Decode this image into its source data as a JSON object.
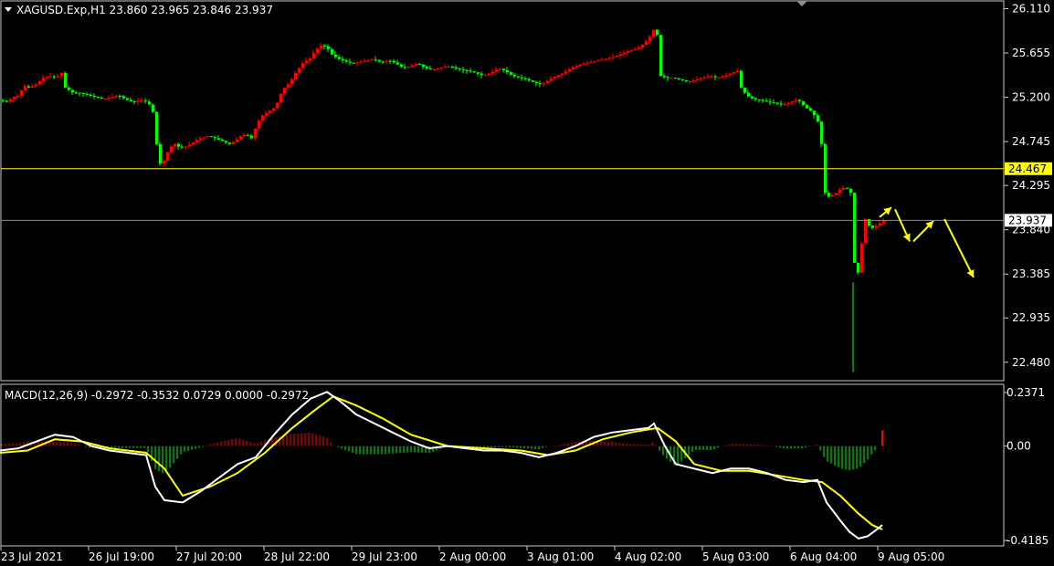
{
  "main_panel": {
    "title": "XAGUSD.Exp,H1  23.860 23.965 23.846 23.937",
    "y_range": [
      22.3,
      26.18
    ],
    "y_ticks": [
      "26.110",
      "25.655",
      "25.200",
      "24.745",
      "24.295",
      "23.840",
      "23.385",
      "22.935",
      "22.480"
    ],
    "hline_level": 24.467,
    "hline_label": "24.467",
    "current_price": 23.937,
    "current_price_label": "23.937",
    "colors": {
      "bull": "#ff0000",
      "bear": "#00ff00",
      "hline": "#ffff00",
      "current_line": "#8c8c9a",
      "arrow": "#ffff00"
    }
  },
  "macd_panel": {
    "title": "MACD(12,26,9) -0.2972 -0.3532 0.0729 0.0000 -0.2972",
    "y_range": [
      -0.4185,
      0.2371
    ],
    "y_ticks": [
      "0.2371",
      "0.00",
      "-0.4185"
    ],
    "colors": {
      "macd": "#ffffff",
      "signal": "#ffff00",
      "hist_pos": "#ff0000",
      "hist_neg": "#00ff00"
    }
  },
  "x_axis_labels": [
    "23 Jul 2021",
    "26 Jul 19:00",
    "27 Jul 20:00",
    "28 Jul 22:00",
    "29 Jul 23:00",
    "2 Aug 00:00",
    "3 Aug 01:00",
    "4 Aug 02:00",
    "5 Aug 03:00",
    "6 Aug 04:00",
    "9 Aug 05:00"
  ],
  "chart_data": [
    {
      "type": "candlestick",
      "symbol": "XAGUSD.Exp",
      "timeframe": "H1",
      "ohlc_last": {
        "open": 23.86,
        "high": 23.965,
        "low": 23.846,
        "close": 23.937
      },
      "horizontal_line": 24.467,
      "path": [
        [
          0,
          25.17
        ],
        [
          7,
          25.15
        ],
        [
          12,
          25.2
        ],
        [
          20,
          25.22
        ],
        [
          24,
          25.32
        ],
        [
          30,
          25.3
        ],
        [
          38,
          25.33
        ],
        [
          46,
          25.4
        ],
        [
          52,
          25.42
        ],
        [
          60,
          25.4
        ],
        [
          66,
          25.45
        ],
        [
          70,
          25.3
        ],
        [
          78,
          25.25
        ],
        [
          88,
          25.24
        ],
        [
          96,
          25.22
        ],
        [
          104,
          25.2
        ],
        [
          112,
          25.18
        ],
        [
          120,
          25.2
        ],
        [
          128,
          25.22
        ],
        [
          136,
          25.18
        ],
        [
          144,
          25.15
        ],
        [
          152,
          25.17
        ],
        [
          160,
          25.15
        ],
        [
          164,
          25.1
        ],
        [
          168,
          25.0
        ],
        [
          170,
          24.72
        ],
        [
          174,
          24.52
        ],
        [
          178,
          24.55
        ],
        [
          184,
          24.68
        ],
        [
          190,
          24.72
        ],
        [
          196,
          24.68
        ],
        [
          204,
          24.7
        ],
        [
          212,
          24.75
        ],
        [
          218,
          24.78
        ],
        [
          226,
          24.8
        ],
        [
          234,
          24.78
        ],
        [
          242,
          24.75
        ],
        [
          250,
          24.72
        ],
        [
          256,
          24.75
        ],
        [
          262,
          24.8
        ],
        [
          268,
          24.82
        ],
        [
          274,
          24.78
        ],
        [
          278,
          24.88
        ],
        [
          284,
          25.0
        ],
        [
          292,
          25.05
        ],
        [
          300,
          25.1
        ],
        [
          308,
          25.28
        ],
        [
          316,
          25.35
        ],
        [
          322,
          25.45
        ],
        [
          330,
          25.55
        ],
        [
          338,
          25.6
        ],
        [
          344,
          25.68
        ],
        [
          350,
          25.73
        ],
        [
          356,
          25.72
        ],
        [
          362,
          25.64
        ],
        [
          368,
          25.6
        ],
        [
          376,
          25.57
        ],
        [
          384,
          25.55
        ],
        [
          392,
          25.56
        ],
        [
          400,
          25.58
        ],
        [
          408,
          25.59
        ],
        [
          416,
          25.56
        ],
        [
          424,
          25.58
        ],
        [
          432,
          25.55
        ],
        [
          440,
          25.5
        ],
        [
          448,
          25.52
        ],
        [
          456,
          25.55
        ],
        [
          464,
          25.5
        ],
        [
          472,
          25.48
        ],
        [
          480,
          25.5
        ],
        [
          488,
          25.52
        ],
        [
          496,
          25.5
        ],
        [
          504,
          25.48
        ],
        [
          512,
          25.47
        ],
        [
          520,
          25.45
        ],
        [
          528,
          25.42
        ],
        [
          536,
          25.45
        ],
        [
          544,
          25.5
        ],
        [
          552,
          25.47
        ],
        [
          560,
          25.42
        ],
        [
          568,
          25.4
        ],
        [
          576,
          25.38
        ],
        [
          584,
          25.35
        ],
        [
          592,
          25.33
        ],
        [
          600,
          25.38
        ],
        [
          608,
          25.42
        ],
        [
          616,
          25.45
        ],
        [
          624,
          25.5
        ],
        [
          632,
          25.53
        ],
        [
          640,
          25.55
        ],
        [
          648,
          25.57
        ],
        [
          656,
          25.58
        ],
        [
          664,
          25.6
        ],
        [
          672,
          25.62
        ],
        [
          680,
          25.65
        ],
        [
          688,
          25.68
        ],
        [
          696,
          25.7
        ],
        [
          704,
          25.75
        ],
        [
          710,
          25.82
        ],
        [
          716,
          25.93
        ],
        [
          720,
          25.75
        ],
        [
          722,
          25.42
        ],
        [
          728,
          25.4
        ],
        [
          736,
          25.4
        ],
        [
          744,
          25.38
        ],
        [
          752,
          25.36
        ],
        [
          760,
          25.38
        ],
        [
          768,
          25.4
        ],
        [
          776,
          25.42
        ],
        [
          784,
          25.4
        ],
        [
          792,
          25.42
        ],
        [
          800,
          25.45
        ],
        [
          806,
          25.47
        ],
        [
          810,
          25.3
        ],
        [
          816,
          25.22
        ],
        [
          824,
          25.18
        ],
        [
          832,
          25.17
        ],
        [
          840,
          25.15
        ],
        [
          848,
          25.14
        ],
        [
          856,
          25.12
        ],
        [
          864,
          25.15
        ],
        [
          872,
          25.18
        ],
        [
          880,
          25.1
        ],
        [
          888,
          25.05
        ],
        [
          894,
          24.95
        ],
        [
          898,
          24.72
        ],
        [
          902,
          24.22
        ],
        [
          906,
          24.18
        ],
        [
          912,
          24.2
        ],
        [
          918,
          24.25
        ],
        [
          924,
          24.28
        ],
        [
          930,
          24.22
        ],
        [
          934,
          23.5
        ],
        [
          936,
          22.8
        ],
        [
          938,
          23.4
        ],
        [
          942,
          23.7
        ],
        [
          946,
          23.95
        ],
        [
          952,
          23.85
        ],
        [
          958,
          23.88
        ],
        [
          964,
          23.92
        ],
        [
          968,
          23.94
        ]
      ],
      "predicted_path_arrows": [
        [
          [
            963,
            23.97
          ],
          [
            976,
            24.07
          ]
        ],
        [
          [
            980,
            24.05
          ],
          [
            996,
            23.72
          ]
        ],
        [
          [
            1000,
            23.72
          ],
          [
            1022,
            23.93
          ]
        ],
        [
          [
            1034,
            23.95
          ],
          [
            1066,
            23.35
          ]
        ]
      ]
    },
    {
      "type": "line",
      "name": "MACD(12,26,9)",
      "series": [
        {
          "name": "macd",
          "values": [
            [
              0,
              -0.02
            ],
            [
              20,
              -0.01
            ],
            [
              40,
              0.02
            ],
            [
              60,
              0.05
            ],
            [
              80,
              0.04
            ],
            [
              100,
              0.0
            ],
            [
              120,
              -0.02
            ],
            [
              140,
              -0.03
            ],
            [
              160,
              -0.04
            ],
            [
              170,
              -0.18
            ],
            [
              180,
              -0.24
            ],
            [
              200,
              -0.25
            ],
            [
              220,
              -0.2
            ],
            [
              240,
              -0.14
            ],
            [
              260,
              -0.08
            ],
            [
              280,
              -0.05
            ],
            [
              300,
              0.05
            ],
            [
              320,
              0.14
            ],
            [
              340,
              0.21
            ],
            [
              358,
              0.24
            ],
            [
              372,
              0.2
            ],
            [
              390,
              0.14
            ],
            [
              410,
              0.1
            ],
            [
              430,
              0.06
            ],
            [
              450,
              0.02
            ],
            [
              470,
              -0.01
            ],
            [
              490,
              0.0
            ],
            [
              510,
              -0.01
            ],
            [
              530,
              -0.02
            ],
            [
              550,
              -0.02
            ],
            [
              570,
              -0.03
            ],
            [
              590,
              -0.05
            ],
            [
              610,
              -0.03
            ],
            [
              630,
              0.0
            ],
            [
              650,
              0.04
            ],
            [
              670,
              0.06
            ],
            [
              690,
              0.07
            ],
            [
              710,
              0.08
            ],
            [
              716,
              0.1
            ],
            [
              728,
              0.0
            ],
            [
              740,
              -0.08
            ],
            [
              760,
              -0.1
            ],
            [
              780,
              -0.12
            ],
            [
              800,
              -0.1
            ],
            [
              820,
              -0.1
            ],
            [
              840,
              -0.12
            ],
            [
              860,
              -0.15
            ],
            [
              880,
              -0.16
            ],
            [
              895,
              -0.15
            ],
            [
              905,
              -0.25
            ],
            [
              920,
              -0.33
            ],
            [
              930,
              -0.38
            ],
            [
              940,
              -0.41
            ],
            [
              950,
              -0.4
            ],
            [
              960,
              -0.37
            ],
            [
              966,
              -0.35
            ]
          ]
        },
        {
          "name": "signal",
          "values": [
            [
              0,
              -0.03
            ],
            [
              30,
              -0.02
            ],
            [
              60,
              0.03
            ],
            [
              90,
              0.02
            ],
            [
              120,
              -0.01
            ],
            [
              160,
              -0.03
            ],
            [
              180,
              -0.1
            ],
            [
              200,
              -0.22
            ],
            [
              230,
              -0.18
            ],
            [
              260,
              -0.12
            ],
            [
              290,
              -0.03
            ],
            [
              320,
              0.08
            ],
            [
              345,
              0.16
            ],
            [
              365,
              0.22
            ],
            [
              390,
              0.18
            ],
            [
              420,
              0.12
            ],
            [
              450,
              0.05
            ],
            [
              490,
              0.0
            ],
            [
              530,
              -0.01
            ],
            [
              570,
              -0.02
            ],
            [
              600,
              -0.04
            ],
            [
              630,
              -0.02
            ],
            [
              660,
              0.03
            ],
            [
              690,
              0.06
            ],
            [
              720,
              0.08
            ],
            [
              740,
              0.02
            ],
            [
              760,
              -0.08
            ],
            [
              790,
              -0.11
            ],
            [
              820,
              -0.11
            ],
            [
              850,
              -0.13
            ],
            [
              880,
              -0.15
            ],
            [
              900,
              -0.16
            ],
            [
              920,
              -0.22
            ],
            [
              940,
              -0.3
            ],
            [
              955,
              -0.35
            ],
            [
              966,
              -0.37
            ]
          ]
        }
      ]
    }
  ]
}
